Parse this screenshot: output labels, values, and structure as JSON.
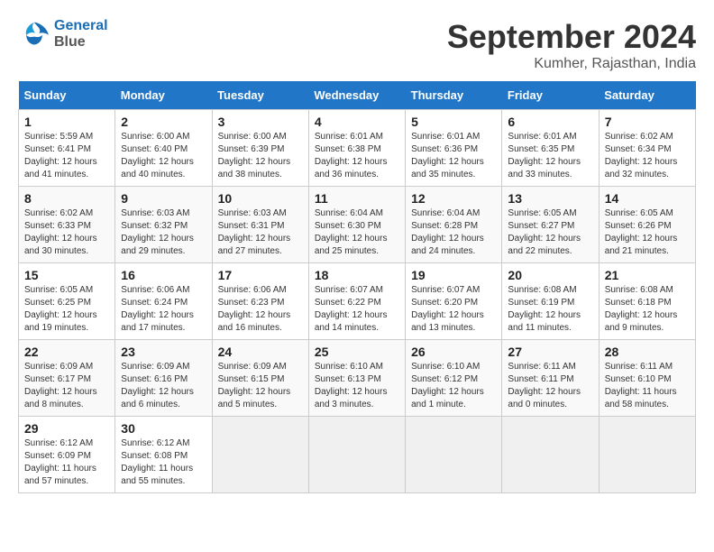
{
  "logo": {
    "line1": "General",
    "line2": "Blue"
  },
  "title": "September 2024",
  "subtitle": "Kumher, Rajasthan, India",
  "weekdays": [
    "Sunday",
    "Monday",
    "Tuesday",
    "Wednesday",
    "Thursday",
    "Friday",
    "Saturday"
  ],
  "days": [
    {
      "num": "",
      "sun": "",
      "mon": "",
      "tue": "",
      "wed": "",
      "thu": "",
      "fri": "",
      "sat": ""
    },
    {
      "cells": [
        {
          "num": "1",
          "detail": "Sunrise: 5:59 AM\nSunset: 6:41 PM\nDaylight: 12 hours\nand 41 minutes."
        },
        {
          "num": "2",
          "detail": "Sunrise: 6:00 AM\nSunset: 6:40 PM\nDaylight: 12 hours\nand 40 minutes."
        },
        {
          "num": "3",
          "detail": "Sunrise: 6:00 AM\nSunset: 6:39 PM\nDaylight: 12 hours\nand 38 minutes."
        },
        {
          "num": "4",
          "detail": "Sunrise: 6:01 AM\nSunset: 6:38 PM\nDaylight: 12 hours\nand 36 minutes."
        },
        {
          "num": "5",
          "detail": "Sunrise: 6:01 AM\nSunset: 6:36 PM\nDaylight: 12 hours\nand 35 minutes."
        },
        {
          "num": "6",
          "detail": "Sunrise: 6:01 AM\nSunset: 6:35 PM\nDaylight: 12 hours\nand 33 minutes."
        },
        {
          "num": "7",
          "detail": "Sunrise: 6:02 AM\nSunset: 6:34 PM\nDaylight: 12 hours\nand 32 minutes."
        }
      ]
    },
    {
      "cells": [
        {
          "num": "8",
          "detail": "Sunrise: 6:02 AM\nSunset: 6:33 PM\nDaylight: 12 hours\nand 30 minutes."
        },
        {
          "num": "9",
          "detail": "Sunrise: 6:03 AM\nSunset: 6:32 PM\nDaylight: 12 hours\nand 29 minutes."
        },
        {
          "num": "10",
          "detail": "Sunrise: 6:03 AM\nSunset: 6:31 PM\nDaylight: 12 hours\nand 27 minutes."
        },
        {
          "num": "11",
          "detail": "Sunrise: 6:04 AM\nSunset: 6:30 PM\nDaylight: 12 hours\nand 25 minutes."
        },
        {
          "num": "12",
          "detail": "Sunrise: 6:04 AM\nSunset: 6:28 PM\nDaylight: 12 hours\nand 24 minutes."
        },
        {
          "num": "13",
          "detail": "Sunrise: 6:05 AM\nSunset: 6:27 PM\nDaylight: 12 hours\nand 22 minutes."
        },
        {
          "num": "14",
          "detail": "Sunrise: 6:05 AM\nSunset: 6:26 PM\nDaylight: 12 hours\nand 21 minutes."
        }
      ]
    },
    {
      "cells": [
        {
          "num": "15",
          "detail": "Sunrise: 6:05 AM\nSunset: 6:25 PM\nDaylight: 12 hours\nand 19 minutes."
        },
        {
          "num": "16",
          "detail": "Sunrise: 6:06 AM\nSunset: 6:24 PM\nDaylight: 12 hours\nand 17 minutes."
        },
        {
          "num": "17",
          "detail": "Sunrise: 6:06 AM\nSunset: 6:23 PM\nDaylight: 12 hours\nand 16 minutes."
        },
        {
          "num": "18",
          "detail": "Sunrise: 6:07 AM\nSunset: 6:22 PM\nDaylight: 12 hours\nand 14 minutes."
        },
        {
          "num": "19",
          "detail": "Sunrise: 6:07 AM\nSunset: 6:20 PM\nDaylight: 12 hours\nand 13 minutes."
        },
        {
          "num": "20",
          "detail": "Sunrise: 6:08 AM\nSunset: 6:19 PM\nDaylight: 12 hours\nand 11 minutes."
        },
        {
          "num": "21",
          "detail": "Sunrise: 6:08 AM\nSunset: 6:18 PM\nDaylight: 12 hours\nand 9 minutes."
        }
      ]
    },
    {
      "cells": [
        {
          "num": "22",
          "detail": "Sunrise: 6:09 AM\nSunset: 6:17 PM\nDaylight: 12 hours\nand 8 minutes."
        },
        {
          "num": "23",
          "detail": "Sunrise: 6:09 AM\nSunset: 6:16 PM\nDaylight: 12 hours\nand 6 minutes."
        },
        {
          "num": "24",
          "detail": "Sunrise: 6:09 AM\nSunset: 6:15 PM\nDaylight: 12 hours\nand 5 minutes."
        },
        {
          "num": "25",
          "detail": "Sunrise: 6:10 AM\nSunset: 6:13 PM\nDaylight: 12 hours\nand 3 minutes."
        },
        {
          "num": "26",
          "detail": "Sunrise: 6:10 AM\nSunset: 6:12 PM\nDaylight: 12 hours\nand 1 minute."
        },
        {
          "num": "27",
          "detail": "Sunrise: 6:11 AM\nSunset: 6:11 PM\nDaylight: 12 hours\nand 0 minutes."
        },
        {
          "num": "28",
          "detail": "Sunrise: 6:11 AM\nSunset: 6:10 PM\nDaylight: 11 hours\nand 58 minutes."
        }
      ]
    },
    {
      "cells": [
        {
          "num": "29",
          "detail": "Sunrise: 6:12 AM\nSunset: 6:09 PM\nDaylight: 11 hours\nand 57 minutes."
        },
        {
          "num": "30",
          "detail": "Sunrise: 6:12 AM\nSunset: 6:08 PM\nDaylight: 11 hours\nand 55 minutes."
        },
        {
          "num": "",
          "detail": ""
        },
        {
          "num": "",
          "detail": ""
        },
        {
          "num": "",
          "detail": ""
        },
        {
          "num": "",
          "detail": ""
        },
        {
          "num": "",
          "detail": ""
        }
      ]
    }
  ]
}
